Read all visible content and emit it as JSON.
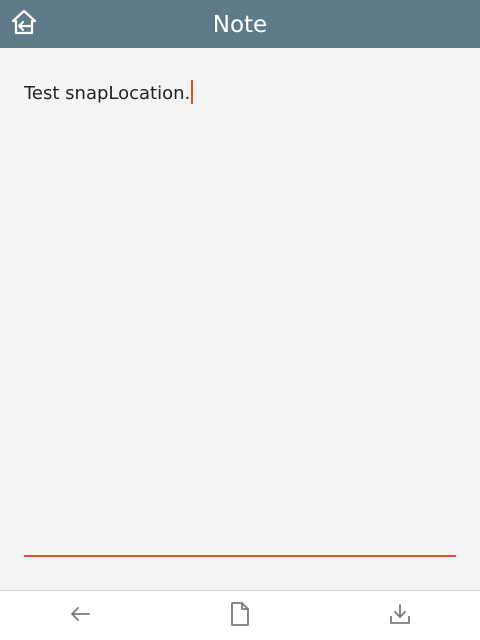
{
  "header": {
    "title": "Note",
    "home_icon": "home-back-icon",
    "background": "#5f7b8a"
  },
  "editor": {
    "text": "Test snapLocation.",
    "caret_color": "#e0532a",
    "underline_color": "#e0532a"
  },
  "toolbar": {
    "items": [
      {
        "icon": "arrow-left-icon"
      },
      {
        "icon": "document-icon"
      },
      {
        "icon": "download-icon"
      }
    ]
  }
}
